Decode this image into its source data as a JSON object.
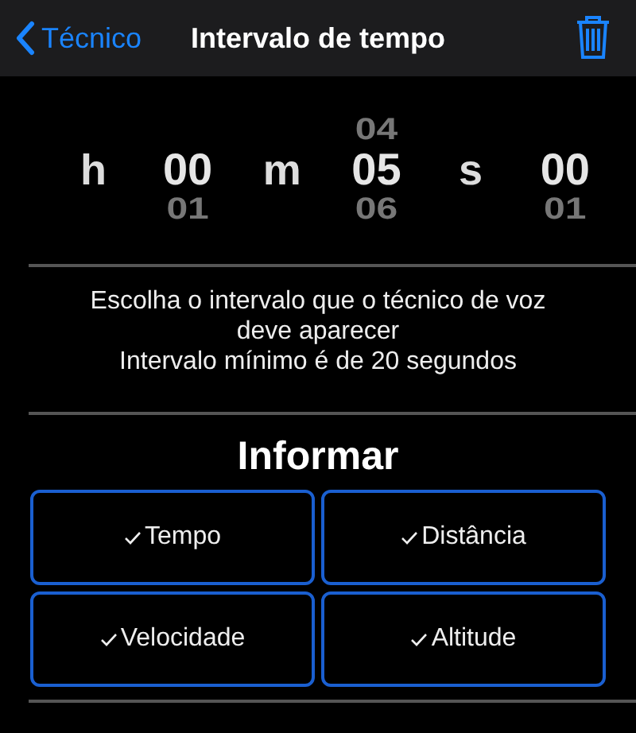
{
  "nav_bar": {
    "back_label": "Técnico",
    "title": "Intervalo de tempo"
  },
  "time_picker": [
    {
      "unit": "h",
      "value": "00",
      "next": "01"
    },
    {
      "unit": "m",
      "previous": "04",
      "value": "05",
      "next": "06"
    },
    {
      "unit": "s",
      "value": "00",
      "next": "01"
    }
  ],
  "description": [
    "Escolha o intervalo que o técnico de voz deve aparecer",
    "Intervalo mínimo é de 20 segundos"
  ],
  "report": {
    "title": "Informar",
    "options": [
      {
        "label": "Tempo",
        "checked": true
      },
      {
        "label": "Distância",
        "checked": true
      },
      {
        "label": "Velocidade",
        "checked": true
      },
      {
        "label": "Altitude",
        "checked": true
      }
    ]
  }
}
